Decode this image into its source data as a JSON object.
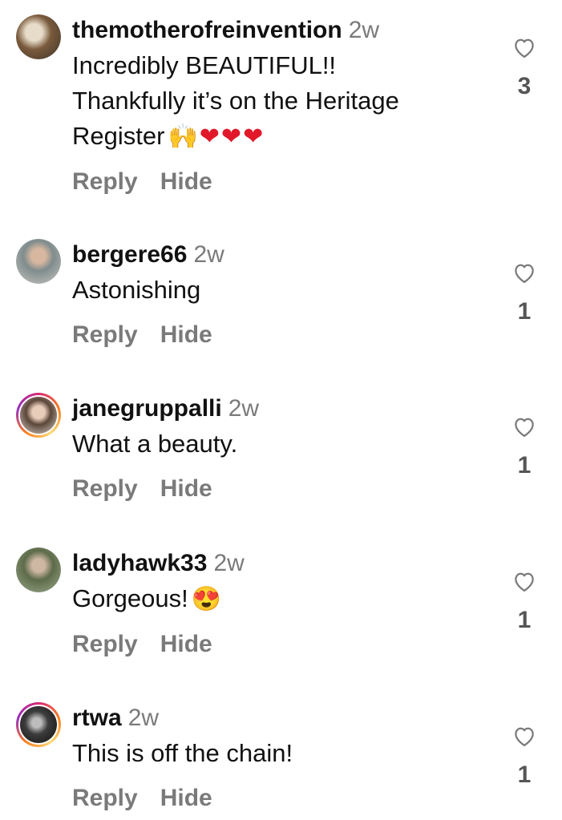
{
  "comments": [
    {
      "username": "themotherofreinvention",
      "time": "2w",
      "lines": [
        "Incredibly BEAUTIFUL!!",
        "Thankfully it’s on the Heritage",
        "Register"
      ],
      "emoji": "🙌❤❤❤",
      "likes": "3",
      "reply": "Reply",
      "hide": "Hide"
    },
    {
      "username": "bergere66",
      "time": "2w",
      "text": "Astonishing",
      "likes": "1",
      "reply": "Reply",
      "hide": "Hide"
    },
    {
      "username": "janegruppalli",
      "time": "2w",
      "text": "What a beauty.",
      "likes": "1",
      "reply": "Reply",
      "hide": "Hide"
    },
    {
      "username": "ladyhawk33",
      "time": "2w",
      "text": "Gorgeous!",
      "emoji": "😍",
      "likes": "1",
      "reply": "Reply",
      "hide": "Hide"
    },
    {
      "username": "rtwa",
      "time": "2w",
      "text": "This is off the chain!",
      "likes": "1",
      "reply": "Reply",
      "hide": "Hide"
    }
  ],
  "icons": {
    "like": "heart-outline-icon"
  },
  "colors": {
    "username": "#111111",
    "meta": "#7a7a7a",
    "story_ring": "#d62976"
  }
}
